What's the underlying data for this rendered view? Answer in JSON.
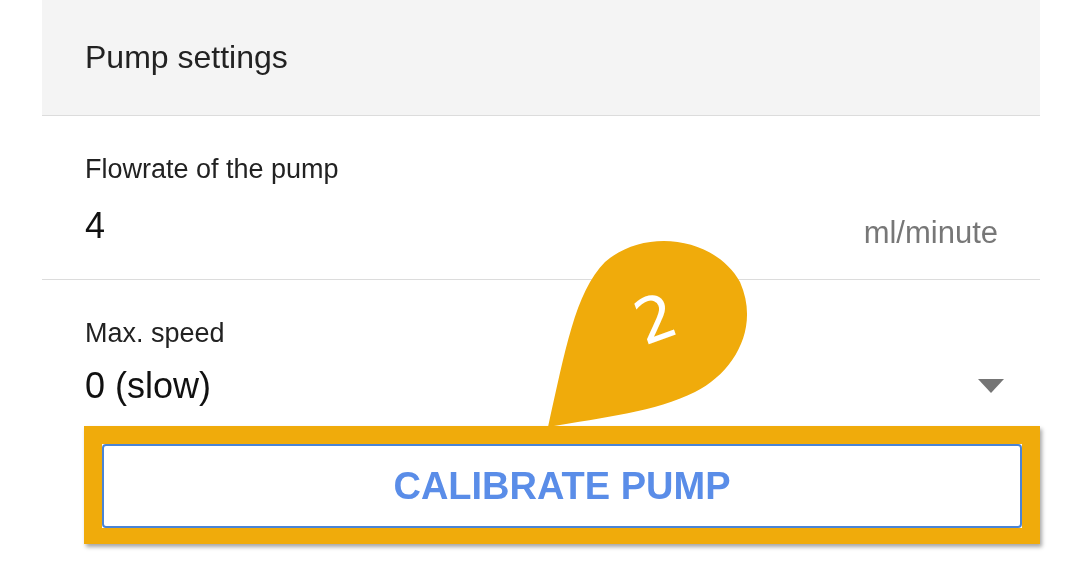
{
  "panel": {
    "title": "Pump settings"
  },
  "fields": [
    {
      "kind": "number",
      "label": "Flowrate of the pump",
      "value": "4",
      "unit": "ml/minute"
    },
    {
      "kind": "dropdown",
      "label": "Max. speed",
      "value": "0 (slow)"
    }
  ],
  "button": {
    "label": "CALIBRATE PUMP",
    "highlighted": true
  },
  "callout": {
    "number": "2"
  }
}
